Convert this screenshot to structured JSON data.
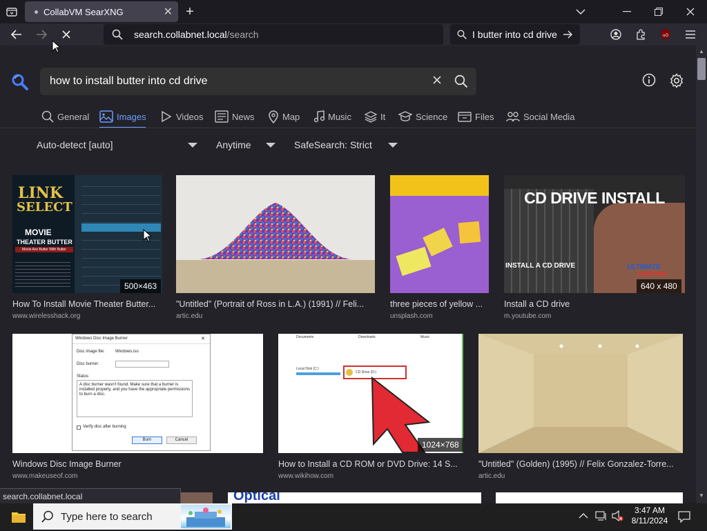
{
  "browser": {
    "tab_title": "CollabVM SearXNG",
    "url_host": "search.collabnet.local",
    "url_path": "/search",
    "search_box_value": "I butter into cd drive"
  },
  "search": {
    "query": "how to install butter into cd drive",
    "categories": [
      "General",
      "Images",
      "Videos",
      "News",
      "Map",
      "Music",
      "It",
      "Science",
      "Files",
      "Social Media"
    ],
    "active_category": "Images",
    "filters": {
      "language": "Auto-detect [auto]",
      "time": "Anytime",
      "safesearch": "SafeSearch: Strict"
    }
  },
  "results": [
    {
      "title": "How To Install Movie Theater Butter...",
      "source": "www.wirelesshack.org",
      "dimensions": "500×463",
      "img_text": [
        "LINK",
        "SELECT",
        "MOVIE",
        "THEATER BUTTER",
        "Movie Ace Butter With Butter"
      ]
    },
    {
      "title": "\"Untitled\" (Portrait of Ross in L.A.) (1991) // Feli...",
      "source": "artic.edu"
    },
    {
      "title": "three pieces of yellow ...",
      "source": "unsplash.com"
    },
    {
      "title": "Install a CD drive",
      "source": "m.youtube.com",
      "dimensions": "640 x 480",
      "img_text": [
        "CD DRIVE INSTALL",
        "INSTALL A CD DRIVE",
        "ULTIMATE",
        "HANDYMAN"
      ]
    },
    {
      "title": "Windows Disc Image Burner",
      "source": "www.makeuseof.com",
      "img_text": {
        "window": "Windows Disc Image Burner",
        "file_label": "Disc image file:",
        "file_value": "Windows.iso",
        "burner_label": "Disc burner:",
        "status_label": "Status",
        "status_text": "A disc burner wasn't found. Make sure that a burner is installed properly, and you have the appropriate permissions to burn a disc.",
        "verify": "Verify disc after burning",
        "burn": "Burn",
        "cancel": "Cancel"
      }
    },
    {
      "title": "How to Install a CD ROM or DVD Drive: 14 S...",
      "source": "www.wikihow.com",
      "dimensions": "1024×768",
      "img_text": [
        "Documents",
        "Downloads",
        "Music",
        "Local Disk (C:)",
        "CD Drive (D:)"
      ]
    },
    {
      "title": "\"Untitled\" (Golden) (1995) // Felix Gonzalez-Torre...",
      "source": "artic.edu"
    }
  ],
  "partial_row_text": "Optical",
  "status_bar": "search.collabnet.local",
  "taskbar": {
    "search_placeholder": "Type here to search",
    "time": "3:47 AM",
    "date": "8/11/2024"
  },
  "colors": {
    "accent": "#6d9eff",
    "page_bg": "#222228",
    "chrome_bg": "#2b2a33"
  }
}
